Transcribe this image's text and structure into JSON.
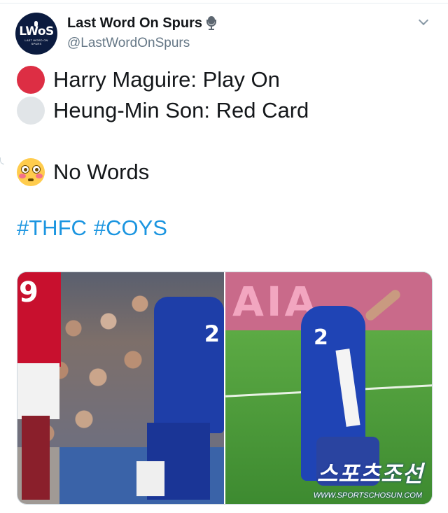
{
  "tweet": {
    "author": {
      "display_name": "Last Word On Spurs",
      "handle": "@LastWordOnSpurs",
      "avatar_text": "LWoS",
      "avatar_subtext": "LAST WORD ON SPURS",
      "badge_icon": "microphone-icon"
    },
    "menu_icon": "chevron-down-icon",
    "lines": [
      {
        "emoji": "red-circle-icon",
        "text": "Harry Maguire: Play On"
      },
      {
        "emoji": "white-circle-icon",
        "text": "Heung-Min Son: Red Card"
      },
      {
        "emoji": "flushed-face-icon",
        "text": "No Words"
      }
    ],
    "hashtags": [
      "#THFC",
      "#COYS"
    ],
    "media": {
      "left_photo": {
        "shirt_numbers": [
          "9",
          "2"
        ]
      },
      "right_photo": {
        "shirt_number": "2",
        "watermark": "스포츠조선",
        "watermark_url": "WWW.SPORTSCHOSUN.COM"
      }
    },
    "colors": {
      "hashtag": "#1b95e0",
      "red_circle": "#dd2e44",
      "white_circle": "#e1e5e8",
      "handle": "#657786"
    }
  }
}
